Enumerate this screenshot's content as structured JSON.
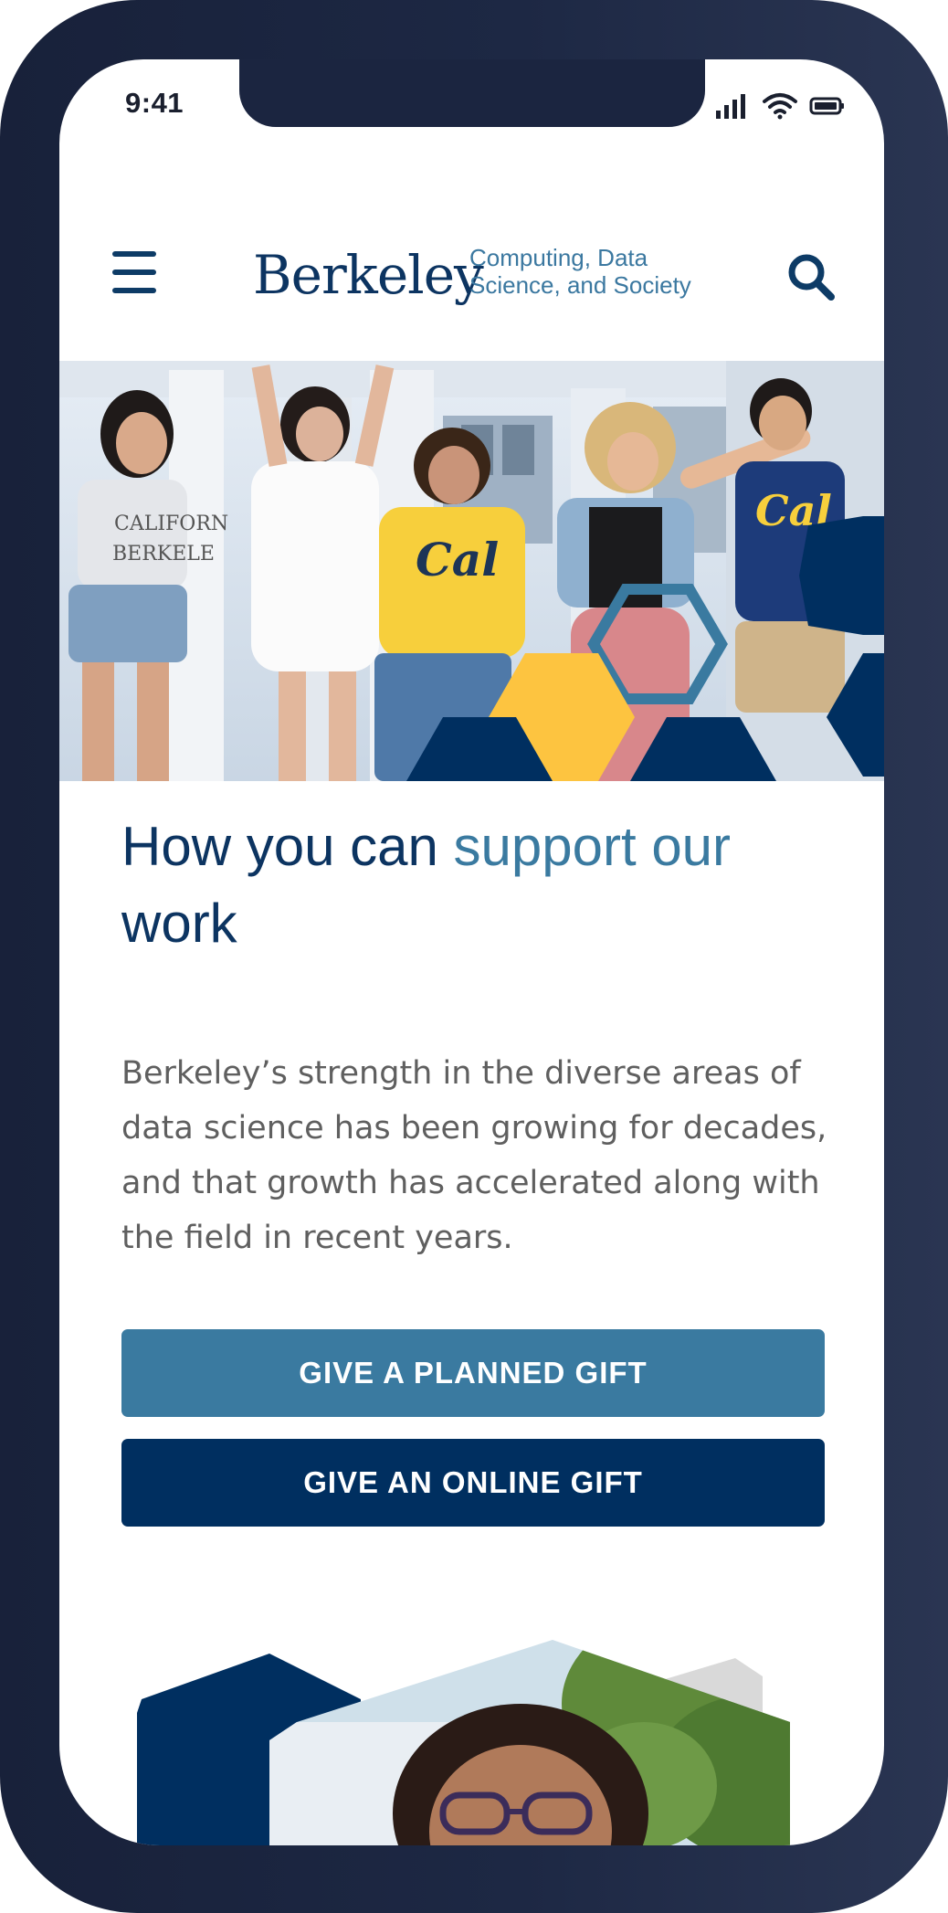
{
  "status_bar": {
    "time": "9:41"
  },
  "header": {
    "logo_word": "Berkeley",
    "logo_sub_line1": "Computing, Data",
    "logo_sub_line2": "Science, and Society",
    "menu_icon": "hamburger-menu-icon",
    "search_icon": "search-icon"
  },
  "hero": {
    "shirt_texts": [
      "CALIFORN",
      "BERKELE",
      "Cal",
      "Cal"
    ]
  },
  "main": {
    "heading_part1": "How you can ",
    "heading_part2": "support our",
    "heading_part3": "work",
    "body": "Berkeley’s strength in the diverse areas of data science has been growing for decades, and that growth has accelerated along with the field in recent years."
  },
  "buttons": {
    "planned_gift": "GIVE A PLANNED GIFT",
    "online_gift": "GIVE AN ONLINE GIFT"
  },
  "colors": {
    "navy": "#002f60",
    "steel_blue": "#3a7aa0",
    "gold": "#fdc440",
    "frame": "#1d2844"
  }
}
